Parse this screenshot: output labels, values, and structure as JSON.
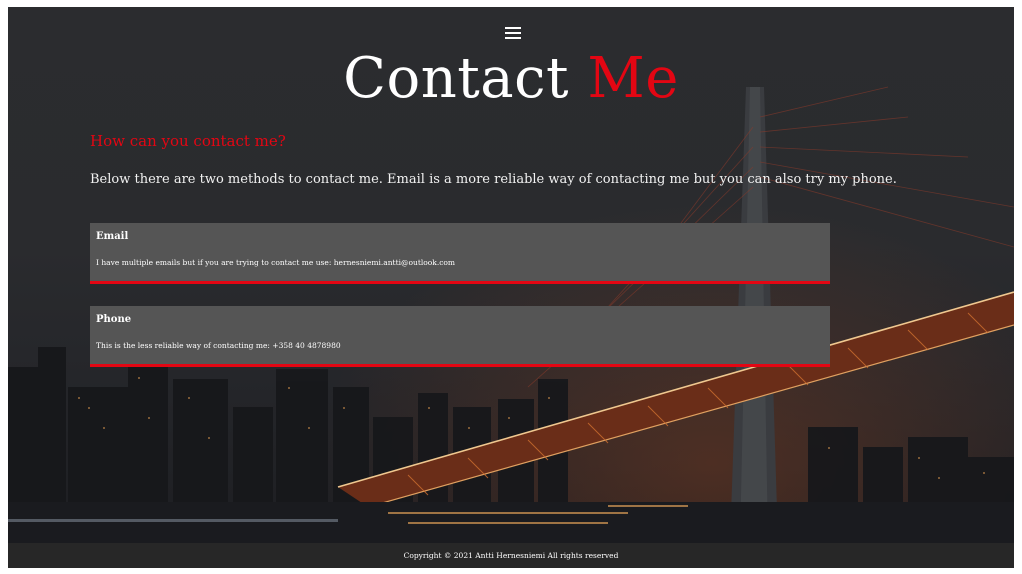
{
  "header": {
    "menu_icon": "hamburger-menu-icon"
  },
  "title": {
    "main": "Contact",
    "accent": "Me",
    "accent_color": "#e30613"
  },
  "section": {
    "heading": "How can you contact me?",
    "intro": "Below there are two methods to contact me. Email is a more reliable way of contacting me but you can also try my phone."
  },
  "methods": [
    {
      "label": "Email",
      "text": "I have multiple emails but if you are trying to contact me use: hernesniemi.antti@outlook.com"
    },
    {
      "label": "Phone",
      "text": "This is the less reliable way of contacting me: +358 40 4878980"
    }
  ],
  "footer": {
    "copyright": "Copyright © 2021 Antti Hernesniemi All rights reserved"
  }
}
